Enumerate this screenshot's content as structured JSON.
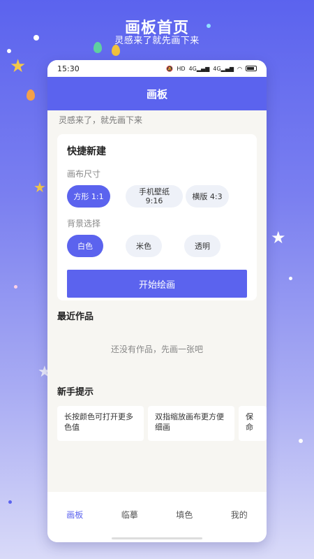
{
  "banner": {
    "title": "画板首页",
    "subtitle": "灵感来了就先画下来"
  },
  "status_bar": {
    "time": "15:30",
    "icons": [
      "mute-icon",
      "hd-icon",
      "4g-signal-icon",
      "4g-signal-icon",
      "wifi-icon",
      "battery-icon"
    ]
  },
  "app_bar": {
    "title": "画板"
  },
  "slogan": "灵感来了，就先画下来",
  "quick_create": {
    "title": "快捷新建",
    "canvas_size_label": "画布尺寸",
    "sizes": [
      {
        "label": "方形 1:1",
        "selected": true
      },
      {
        "label": "手机壁纸\n9:16",
        "selected": false
      },
      {
        "label": "横版 4:3",
        "selected": false
      }
    ],
    "background_label": "背景选择",
    "backgrounds": [
      {
        "label": "白色",
        "selected": true
      },
      {
        "label": "米色",
        "selected": false
      },
      {
        "label": "透明",
        "selected": false
      }
    ],
    "start_button": "开始绘画"
  },
  "recent": {
    "title": "最近作品",
    "empty_text": "还没有作品，先画一张吧"
  },
  "tips": {
    "title": "新手提示",
    "items": [
      "长按颜色可打开更多色值",
      "双指缩放画布更方便细画",
      "保命"
    ]
  },
  "tab_bar": {
    "items": [
      {
        "label": "画板",
        "active": true
      },
      {
        "label": "临摹",
        "active": false
      },
      {
        "label": "填色",
        "active": false
      },
      {
        "label": "我的",
        "active": false
      }
    ]
  },
  "colors": {
    "accent": "#5b63ee",
    "chip_bg": "#eef1f8",
    "page_bg": "#f7f6f2"
  }
}
